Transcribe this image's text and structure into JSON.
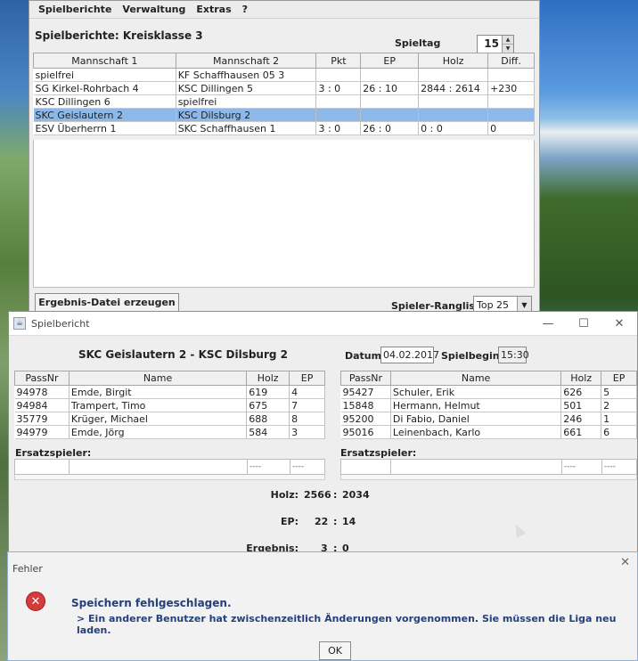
{
  "main_window": {
    "menu": [
      "Spielberichte",
      "Verwaltung",
      "Extras",
      "?"
    ],
    "title": "Spielberichte: Kreisklasse 3",
    "spieltag_label": "Spieltag",
    "spieltag_value": "15",
    "table": {
      "headers": [
        "Mannschaft 1",
        "Mannschaft 2",
        "Pkt",
        "EP",
        "Holz",
        "Diff."
      ],
      "rows": [
        [
          "spielfrei",
          "KF Schaffhausen 05 3",
          "",
          "",
          "",
          ""
        ],
        [
          "SG Kirkel-Rohrbach 4",
          "KSC Dillingen 5",
          "3 : 0",
          "26 : 10",
          "2844 : 2614",
          "+230"
        ],
        [
          "KSC Dillingen 6",
          "spielfrei",
          "",
          "",
          "",
          ""
        ],
        [
          "SKC Geislautern 2",
          "KSC Dilsburg 2",
          "",
          "",
          "",
          ""
        ],
        [
          "ESV Überherrn 1",
          "SKC Schaffhausen 1",
          "3 : 0",
          "26 : 0",
          "0 : 0",
          "0"
        ]
      ]
    },
    "ergebnis_button": "Ergebnis-Datei erzeugen",
    "rangliste_label": "Spieler-Rangliste:",
    "rangliste_value": "Top 25"
  },
  "report_window": {
    "title": "Spielbericht",
    "controls": [
      "—",
      "☐",
      "✕"
    ],
    "match_heading": "SKC Geislautern 2 - KSC Dilsburg 2",
    "datum_label": "Datum:",
    "datum_value": "04.02.2017",
    "beginn_label": "Spielbeginn:",
    "beginn_value": "15:30",
    "headers": [
      "PassNr",
      "Name",
      "Holz",
      "EP"
    ],
    "home_players": [
      [
        "94978",
        "Emde, Birgit",
        "619",
        "4"
      ],
      [
        "94984",
        "Trampert, Timo",
        "675",
        "7"
      ],
      [
        "35779",
        "Krüger, Michael",
        "688",
        "8"
      ],
      [
        "94979",
        "Emde, Jörg",
        "584",
        "3"
      ]
    ],
    "away_players": [
      [
        "95427",
        "Schuler, Erik",
        "626",
        "5"
      ],
      [
        "15848",
        "Hermann, Helmut",
        "501",
        "2"
      ],
      [
        "95200",
        "Di Fabio, Daniel",
        "246",
        "1"
      ],
      [
        "95016",
        "Leinenbach, Karlo",
        "661",
        "6"
      ]
    ],
    "ersatz_label": "Ersatzspieler:",
    "ersatz_placeholder": "----",
    "summary": {
      "holz_label": "Holz:",
      "holz_home": "2566",
      "holz_away": "2034",
      "ep_label": "EP:",
      "ep_home": "22",
      "ep_away": "14",
      "ergebnis_label": "Ergebnis:",
      "ergebnis_home": "3",
      "ergebnis_away": "0",
      "separator": ":"
    }
  },
  "error_dialog": {
    "title": "Fehler",
    "message": "Speichern fehlgeschlagen.",
    "detail": "> Ein anderer Benutzer hat zwischenzeitlich Änderungen vorgenommen. Sie müssen die Liga neu laden.",
    "ok_label": "OK",
    "close_glyph": "✕",
    "icon_glyph": "✕"
  },
  "colors": {
    "selection": "#8db8e8",
    "error_red": "#d63b3b",
    "message_blue": "#243f7a"
  }
}
